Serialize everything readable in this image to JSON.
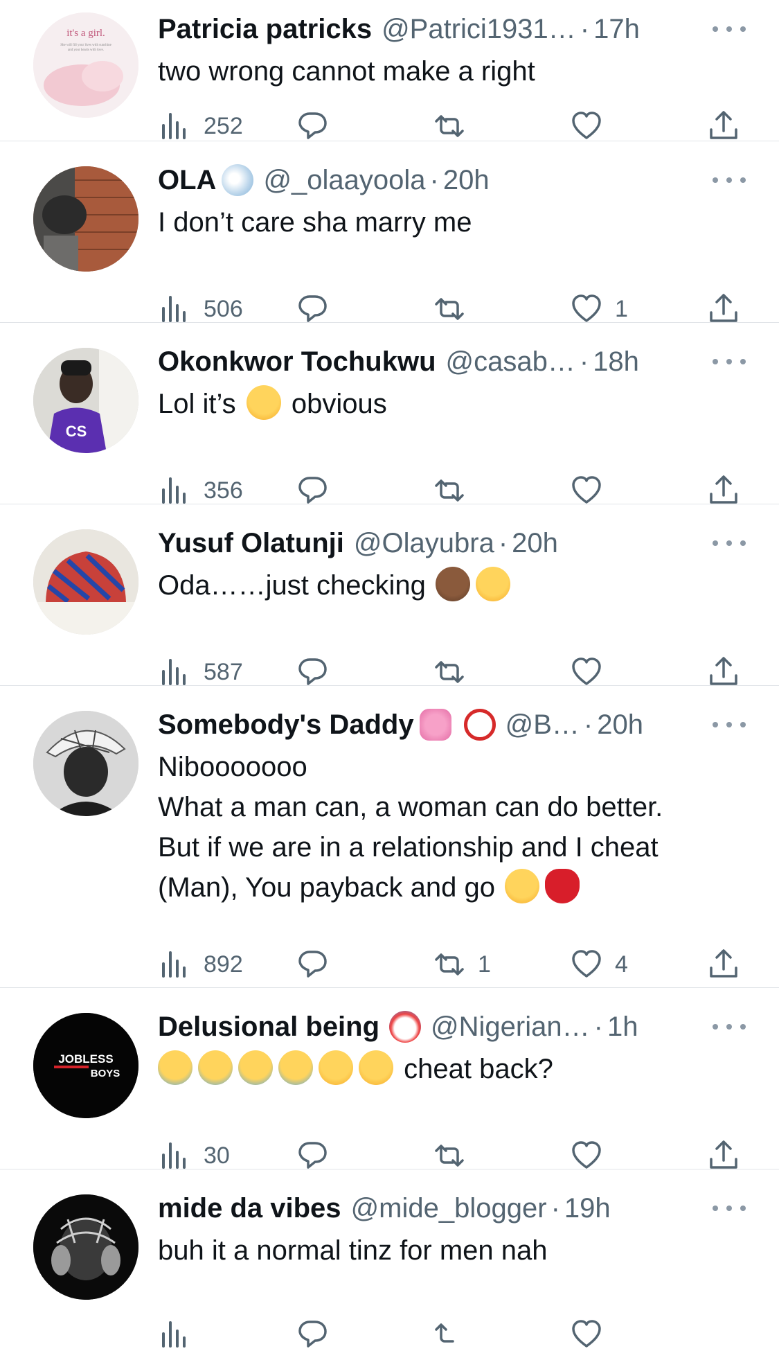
{
  "tweets": [
    {
      "name": "Patricia patricks",
      "handle": "@Patrici1931…",
      "time": "17h",
      "text": [
        "two wrong cannot make a right"
      ],
      "views": "252",
      "replies": "",
      "retweets": "",
      "likes": "",
      "avatar_text": [
        "it's a girl.",
        "She will fill your lives with sunshine",
        "and your hearts with love."
      ]
    },
    {
      "name": "OLA",
      "handle": "@_olaayoola",
      "time": "20h",
      "text": [
        "I don’t care sha marry me"
      ],
      "views": "506",
      "replies": "",
      "retweets": "",
      "likes": "1"
    },
    {
      "name": "Okonkwor Tochukwu",
      "handle": "@casab…",
      "time": "18h",
      "text_parts": [
        "Lol it’s ",
        " obvious"
      ],
      "views": "356",
      "replies": "",
      "retweets": "",
      "likes": ""
    },
    {
      "name": "Yusuf Olatunji",
      "handle": "@Olayubra",
      "time": "20h",
      "text": [
        "Oda……just checking"
      ],
      "views": "587",
      "replies": "",
      "retweets": "",
      "likes": ""
    },
    {
      "name": "Somebody's Daddy",
      "handle": "@B…",
      "time": "20h",
      "text": [
        "Nibooooooo",
        "What a man can, a woman can do better.",
        "But if we are in a relationship and I cheat",
        "(Man), You payback and go"
      ],
      "views": "892",
      "replies": "",
      "retweets": "1",
      "likes": "4"
    },
    {
      "name": "Delusional being",
      "handle": "@Nigerian…",
      "time": "1h",
      "text": [
        "cheat back?"
      ],
      "views": "30",
      "replies": "",
      "retweets": "",
      "likes": "",
      "avatar_text": [
        "JOBLESS",
        "BOYS"
      ]
    },
    {
      "name": "mide da vibes",
      "handle": "@mide_blogger",
      "time": "19h",
      "text": [
        "buh it a normal tinz for men nah"
      ],
      "views": "",
      "replies": "",
      "retweets": "",
      "likes": ""
    }
  ],
  "icons": {
    "views": "views-icon",
    "reply": "reply-icon",
    "retweet": "retweet-icon",
    "like": "like-icon",
    "share": "share-icon",
    "more": "more-icon"
  },
  "colors": {
    "text": "#0f1419",
    "secondary": "#536471",
    "divider": "#e1e4e8"
  }
}
